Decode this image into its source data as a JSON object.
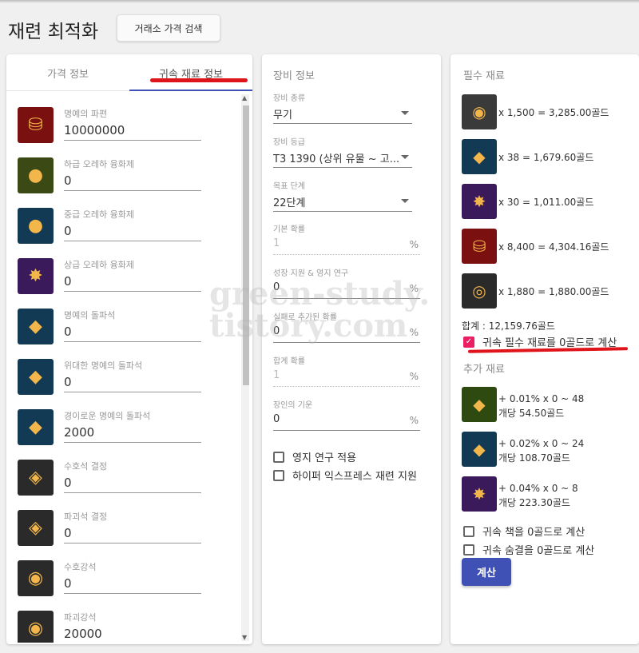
{
  "app": {
    "title": "재련 최적화",
    "search_button": "거래소 가격 검색"
  },
  "left_panel": {
    "tabs": [
      "가격 정보",
      "귀속 재료 정보"
    ],
    "active_tab": 1,
    "materials": [
      {
        "label": "명예의 파편",
        "value": "10000000",
        "icon": "shard-pouch-icon",
        "bg": "#7a1010",
        "glyph": "⛁"
      },
      {
        "label": "하급 오레하 융화제",
        "value": "0",
        "icon": "low-fusion-icon",
        "bg": "#3b4a14",
        "glyph": "●"
      },
      {
        "label": "중급 오레하 융화제",
        "value": "0",
        "icon": "mid-fusion-icon",
        "bg": "#123a55",
        "glyph": "●"
      },
      {
        "label": "상급 오레하 융화제",
        "value": "0",
        "icon": "high-fusion-icon",
        "bg": "#3a1a5a",
        "glyph": "✸"
      },
      {
        "label": "명예의 돌파석",
        "value": "0",
        "icon": "breakthrough-stone-icon",
        "bg": "#123a55",
        "glyph": "◆"
      },
      {
        "label": "위대한 명예의 돌파석",
        "value": "0",
        "icon": "great-breakthrough-stone-icon",
        "bg": "#123a55",
        "glyph": "◆"
      },
      {
        "label": "경이로운 명예의 돌파석",
        "value": "2000",
        "icon": "marvelous-breakthrough-stone-icon",
        "bg": "#123a55",
        "glyph": "◆"
      },
      {
        "label": "수호석 결정",
        "value": "0",
        "icon": "guardian-crystal-icon",
        "bg": "#2a2a2a",
        "glyph": "◈"
      },
      {
        "label": "파괴석 결정",
        "value": "0",
        "icon": "destruction-crystal-icon",
        "bg": "#2a2a2a",
        "glyph": "◈"
      },
      {
        "label": "수호강석",
        "value": "0",
        "icon": "guardian-stone-icon",
        "bg": "#2a2a2a",
        "glyph": "◉"
      },
      {
        "label": "파괴강석",
        "value": "20000",
        "icon": "destruction-stone-icon",
        "bg": "#2a2a2a",
        "glyph": "◉"
      }
    ]
  },
  "equipment": {
    "title": "장비 정보",
    "fields": [
      {
        "label": "장비 종류",
        "value": "무기",
        "kind": "select"
      },
      {
        "label": "장비 등급",
        "value": "T3 1390 (상위 유물 ~ 고...",
        "kind": "select"
      },
      {
        "label": "목표 단계",
        "value": "22단계",
        "kind": "select"
      },
      {
        "label": "기본 확률",
        "value": "1",
        "kind": "disabled",
        "suffix": "%"
      },
      {
        "label": "성장 지원 & 영지 연구",
        "value": "0",
        "kind": "input",
        "suffix": "%"
      },
      {
        "label": "실패로 추가된 확률",
        "value": "0",
        "kind": "input",
        "suffix": "%"
      },
      {
        "label": "합계 확률",
        "value": "1",
        "kind": "disabled",
        "suffix": "%"
      },
      {
        "label": "장인의 기운",
        "value": "0",
        "kind": "input",
        "suffix": "%"
      }
    ],
    "checkboxes": [
      "영지 연구 적용",
      "하이퍼 익스프레스 재련 지원"
    ]
  },
  "results": {
    "required_title": "필수 재료",
    "required": [
      {
        "text": "x 1,500 = 3,285.00골드",
        "icon": "destruction-stone-icon",
        "bg": "#3a3a3a",
        "glyph": "◉"
      },
      {
        "text": "x 38 = 1,679.60골드",
        "icon": "marvelous-breakthrough-stone-icon",
        "bg": "#123a55",
        "glyph": "◆"
      },
      {
        "text": "x 30 = 1,011.00골드",
        "icon": "high-fusion-icon",
        "bg": "#3a1a5a",
        "glyph": "✸"
      },
      {
        "text": "x 8,400 = 4,304.16골드",
        "icon": "shard-pouch-icon",
        "bg": "#7a1010",
        "glyph": "⛁"
      },
      {
        "text": "x 1,880 = 1,880.00골드",
        "icon": "gold-coin-icon",
        "bg": "#2a2a2a",
        "glyph": "◎"
      }
    ],
    "total": "합계 : 12,159.76골드",
    "bound_required_checkbox": "귀속 필수 재료를 0골드로 계산",
    "extra_title": "추가 재료",
    "extra": [
      {
        "line1": "+ 0.01% x 0 ~ 48",
        "line2": "개당 54.50골드",
        "icon": "solar-grace-icon",
        "bg": "#2f4a10",
        "glyph": "◆"
      },
      {
        "line1": "+ 0.02% x 0 ~ 24",
        "line2": "개당 108.70골드",
        "icon": "solar-blessing-icon",
        "bg": "#123a55",
        "glyph": "◆"
      },
      {
        "line1": "+ 0.04% x 0 ~ 8",
        "line2": "개당 223.30골드",
        "icon": "solar-protection-icon",
        "bg": "#3a1a5a",
        "glyph": "✸"
      }
    ],
    "bound_book_checkbox": "귀속 책을 0골드로 계산",
    "bound_breath_checkbox": "귀속 숨결을 0골드로 계산",
    "calculate_button": "계산"
  },
  "watermark": {
    "line1": "green-study.",
    "line2": "tistory.com"
  },
  "colors": {
    "accent": "#3f51b5",
    "annotation_red": "#e0141b",
    "checkbox_checked": "#e91e63"
  }
}
